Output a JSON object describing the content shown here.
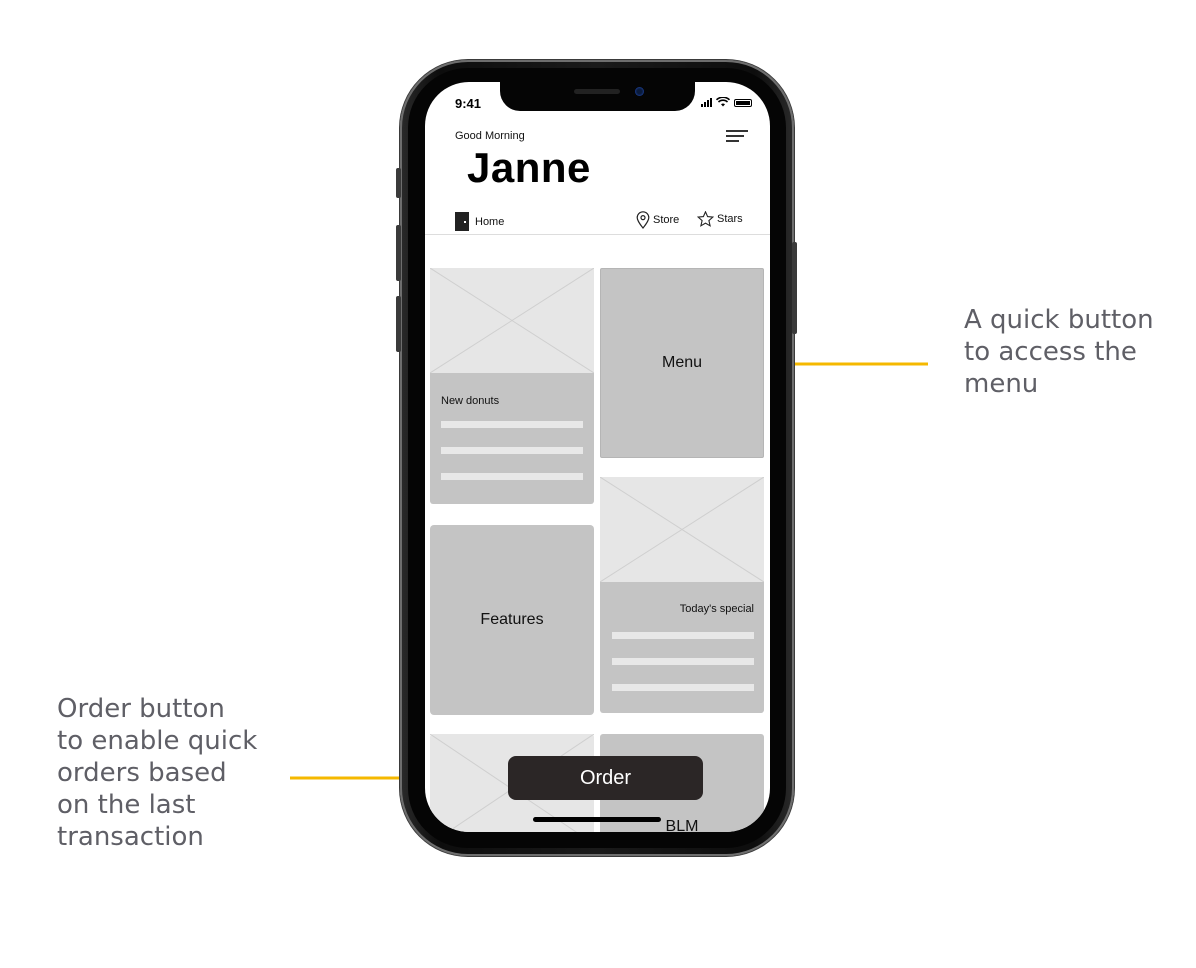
{
  "annotations": {
    "menu_note": "A quick button to access the menu",
    "menu_note_lines": [
      "A quick button",
      "to access the",
      "menu"
    ],
    "order_note_lines": [
      "Order button",
      "to enable quick",
      "orders based",
      "on the last",
      "transaction"
    ],
    "arrow_color": "#F5B800"
  },
  "status_bar": {
    "time": "9:41"
  },
  "header": {
    "greeting": "Good Morning",
    "username": "Janne"
  },
  "nav": {
    "home": "Home",
    "store": "Store",
    "stars": "Stars"
  },
  "cards": {
    "new_donuts": "New donuts",
    "menu": "Menu",
    "features": "Features",
    "todays_special": "Today's special",
    "blm": "BLM"
  },
  "order_button": "Order",
  "colors": {
    "card_gray": "#C4C4C4",
    "placeholder_gray": "#E6E6E6",
    "order_button_bg": "#2B2626"
  }
}
